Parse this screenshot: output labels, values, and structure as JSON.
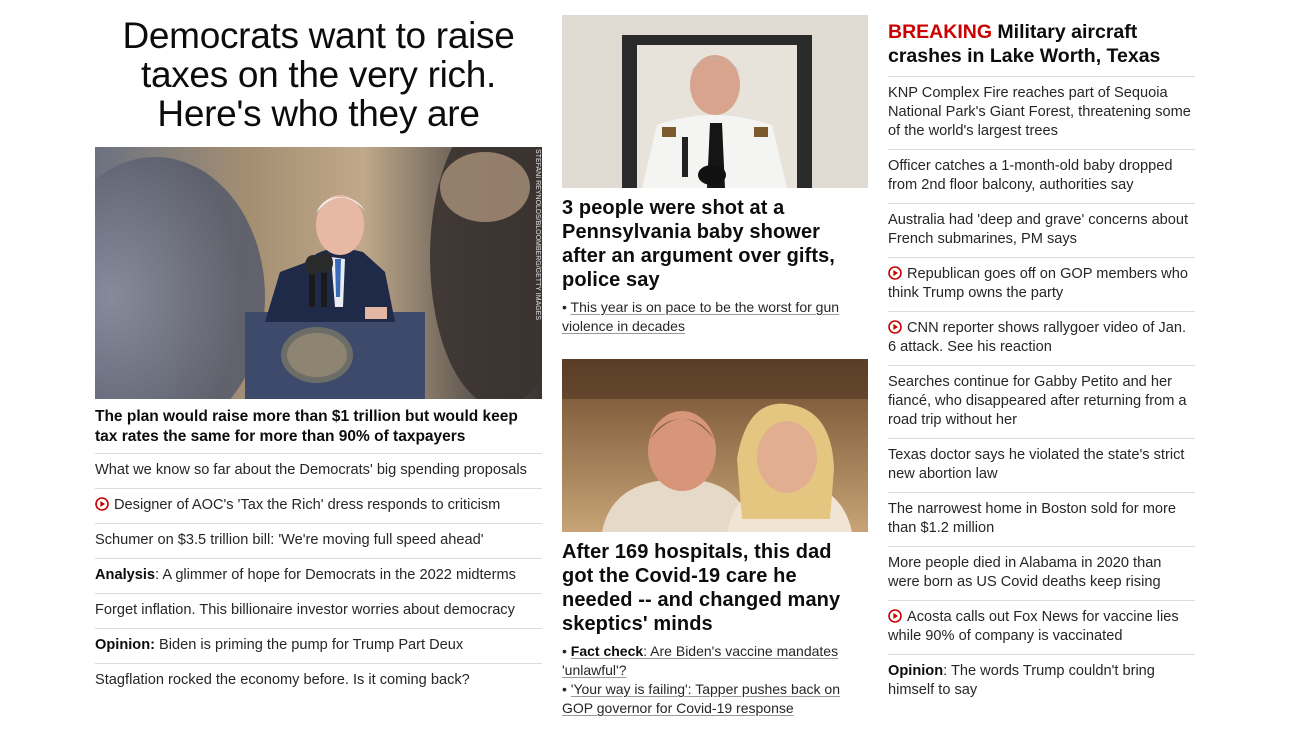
{
  "colors": {
    "accent_red": "#cc0000",
    "text": "#0c0c0c",
    "divider": "#dcdcdc"
  },
  "col1": {
    "headline": "Democrats want to raise taxes on the very rich. Here's who they are",
    "photo_credit": "STEFANI REYNOLDS/BLOOMBERG/GETTY IMAGES",
    "subheadline": "The plan would raise more than $1 trillion but would keep tax rates the same for more than 90% of taxpayers",
    "links": [
      {
        "label": "",
        "text": "What we know so far about the Democrats' big spending proposals",
        "icon": ""
      },
      {
        "label": "",
        "text": "Designer of AOC's 'Tax the Rich' dress responds to criticism",
        "icon": "play-icon"
      },
      {
        "label": "",
        "text": "Schumer on $3.5 trillion bill: 'We're moving full speed ahead'",
        "icon": ""
      },
      {
        "label": "Analysis",
        "text": ": A glimmer of hope for Democrats in the 2022 midterms",
        "icon": ""
      },
      {
        "label": "",
        "text": "Forget inflation. This billionaire investor worries about democracy",
        "icon": ""
      },
      {
        "label": "Opinion:",
        "text": " Biden is priming the pump for Trump Part Deux",
        "icon": ""
      },
      {
        "label": "",
        "text": "Stagflation rocked the economy before. Is it coming back?",
        "icon": ""
      }
    ]
  },
  "col2": {
    "story1": {
      "headline": "3 people were shot at a Pennsylvania baby shower after an argument over gifts, police say",
      "bullets": [
        {
          "label": "",
          "text": "This year is on pace to be the worst for gun violence in decades"
        }
      ]
    },
    "story2": {
      "headline": "After 169 hospitals, this dad got the Covid-19 care he needed -- and changed many skeptics' minds",
      "bullets": [
        {
          "label": "Fact check",
          "text": ": Are Biden's vaccine mandates 'unlawful'?"
        },
        {
          "label": "",
          "text": "'Your way is failing': Tapper pushes back on GOP governor for Covid-19 response"
        }
      ]
    }
  },
  "col3": {
    "breaking_tag": "BREAKING",
    "breaking_text": " Military aircraft crashes in Lake Worth, Texas",
    "links": [
      {
        "label": "",
        "text": "KNP Complex Fire reaches part of Sequoia National Park's Giant Forest, threatening some of the world's largest trees",
        "icon": ""
      },
      {
        "label": "",
        "text": "Officer catches a 1-month-old baby dropped from 2nd floor balcony, authorities say",
        "icon": ""
      },
      {
        "label": "",
        "text": "Australia had 'deep and grave' concerns about French submarines, PM says",
        "icon": ""
      },
      {
        "label": "",
        "text": "Republican goes off on GOP members who think Trump owns the party",
        "icon": "play-icon"
      },
      {
        "label": "",
        "text": "CNN reporter shows rallygoer video of Jan. 6 attack. See his reaction",
        "icon": "play-icon"
      },
      {
        "label": "",
        "text": "Searches continue for Gabby Petito and her fiancé, who disappeared after returning from a road trip without her",
        "icon": ""
      },
      {
        "label": "",
        "text": "Texas doctor says he violated the state's strict new abortion law",
        "icon": ""
      },
      {
        "label": "",
        "text": "The narrowest home in Boston sold for more than $1.2 million",
        "icon": ""
      },
      {
        "label": "",
        "text": "More people died in Alabama in 2020 than were born as US Covid deaths keep rising",
        "icon": ""
      },
      {
        "label": "",
        "text": "Acosta calls out Fox News for vaccine lies while 90% of company is vaccinated",
        "icon": "play-icon"
      },
      {
        "label": "Opinion",
        "text": ": The words Trump couldn't bring himself to say",
        "icon": ""
      }
    ]
  }
}
